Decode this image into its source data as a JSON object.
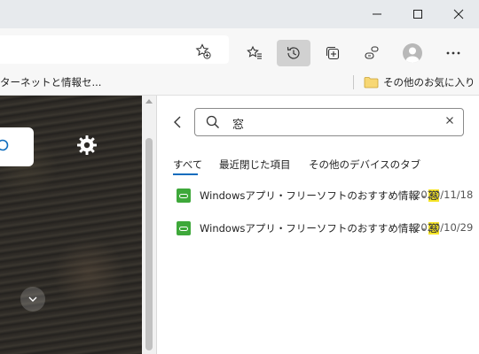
{
  "window": {
    "minimize_icon": "minimize-icon",
    "maximize_icon": "maximize-icon",
    "close_icon": "close-icon"
  },
  "toolbar": {
    "add_favorite_icon": "star-plus-icon",
    "favorites_icon": "favorites-icon",
    "history_icon": "history-icon",
    "collections_icon": "collections-icon",
    "games_icon": "games-icon",
    "profile_icon": "profile-icon",
    "more_icon": "more-icon"
  },
  "favorites_bar": {
    "left_item": "ターネットと情報セ...",
    "folder_label": "その他のお気に入り"
  },
  "history": {
    "search_query": "窓",
    "tabs": [
      {
        "label": "すべて"
      },
      {
        "label": "最近閉じた項目"
      },
      {
        "label": "その他のデバイスのタブ"
      }
    ],
    "items": [
      {
        "title_prefix": "Windowsアプリ・フリーソフトのおすすめ情報 - ",
        "highlight": "窓",
        "date": "2020/11/18"
      },
      {
        "title_prefix": "Windowsアプリ・フリーソフトのおすすめ情報 - ",
        "highlight": "窓",
        "date": "2020/10/29"
      }
    ]
  },
  "colors": {
    "accent": "#0f6cbd",
    "highlight": "#f6e52a",
    "favicon": "#3ea83a"
  }
}
